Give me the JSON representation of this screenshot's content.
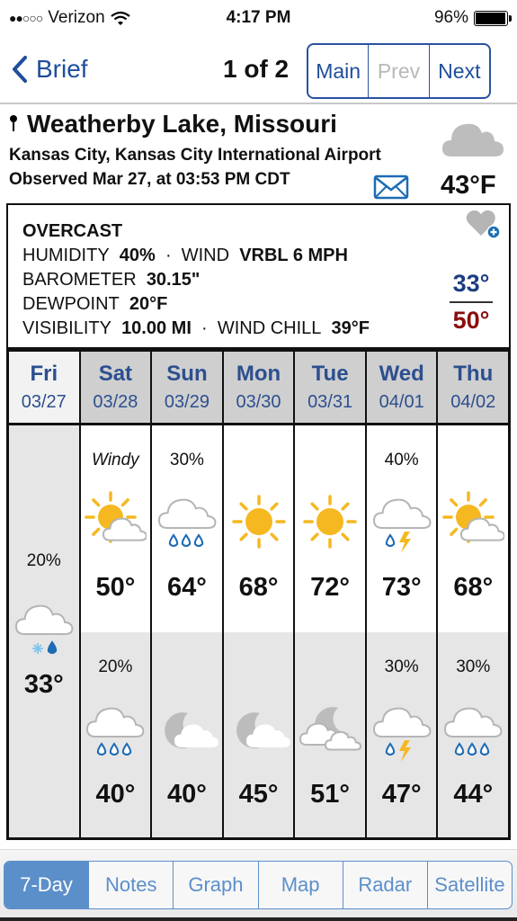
{
  "status_bar": {
    "signal_dots": "●●○○○",
    "carrier": "Verizon",
    "time": "4:17 PM",
    "battery_pct": "96%",
    "battery_level": 0.96
  },
  "nav": {
    "back_label": "Brief",
    "page_indicator": "1 of 2",
    "segments": [
      {
        "label": "Main",
        "enabled": true
      },
      {
        "label": "Prev",
        "enabled": false
      },
      {
        "label": "Next",
        "enabled": true
      }
    ]
  },
  "location": {
    "name": "Weatherby Lake, Missouri",
    "station": "Kansas City, Kansas City International Airport",
    "observed": "Observed Mar 27, at 03:53 PM CDT",
    "current_temp": "43°F",
    "current_icon": "cloud-icon"
  },
  "conditions": {
    "summary": "OVERCAST",
    "humidity_label": "HUMIDITY",
    "humidity": "40%",
    "sep": "·",
    "wind_label": "WIND",
    "wind": "VRBL 6 MPH",
    "barometer_label": "BAROMETER",
    "barometer": "30.15\"",
    "dewpoint_label": "DEWPOINT",
    "dewpoint": "20°F",
    "visibility_label": "VISIBILITY",
    "visibility": "10.00 MI",
    "windchill_label": "WIND CHILL",
    "windchill": "39°F",
    "low": "33°",
    "high": "50°",
    "colors": {
      "low": "#1c3e82",
      "high": "#8b0c0c"
    }
  },
  "forecast": [
    {
      "day": "Fri",
      "date": "03/27",
      "today": true,
      "day_part": null,
      "night": {
        "note": "20%",
        "italic": false,
        "icon": "cloud-snow-rain-icon",
        "temp": "33°"
      }
    },
    {
      "day": "Sat",
      "date": "03/28",
      "day_part": {
        "note": "Windy",
        "italic": true,
        "icon": "partly-sunny-icon",
        "temp": "50°"
      },
      "night": {
        "note": "20%",
        "italic": false,
        "icon": "cloud-rain-icon",
        "temp": "40°"
      }
    },
    {
      "day": "Sun",
      "date": "03/29",
      "day_part": {
        "note": "30%",
        "italic": false,
        "icon": "cloud-rain-icon",
        "temp": "64°"
      },
      "night": {
        "note": "",
        "italic": false,
        "icon": "moon-cloud-icon",
        "temp": "40°"
      }
    },
    {
      "day": "Mon",
      "date": "03/30",
      "day_part": {
        "note": "",
        "italic": false,
        "icon": "sun-icon",
        "temp": "68°"
      },
      "night": {
        "note": "",
        "italic": false,
        "icon": "moon-cloud-icon",
        "temp": "45°"
      }
    },
    {
      "day": "Tue",
      "date": "03/31",
      "day_part": {
        "note": "",
        "italic": false,
        "icon": "sun-icon",
        "temp": "72°"
      },
      "night": {
        "note": "",
        "italic": false,
        "icon": "mostly-cloudy-night-icon",
        "temp": "51°"
      }
    },
    {
      "day": "Wed",
      "date": "04/01",
      "day_part": {
        "note": "40%",
        "italic": false,
        "icon": "thunderstorm-icon",
        "temp": "73°"
      },
      "night": {
        "note": "30%",
        "italic": false,
        "icon": "thunderstorm-icon",
        "temp": "47°"
      }
    },
    {
      "day": "Thu",
      "date": "04/02",
      "day_part": {
        "note": "",
        "italic": false,
        "icon": "partly-sunny-icon",
        "temp": "68°"
      },
      "night": {
        "note": "30%",
        "italic": false,
        "icon": "cloud-rain-icon",
        "temp": "44°"
      }
    }
  ],
  "tabs": [
    {
      "label": "7-Day",
      "active": true
    },
    {
      "label": "Notes",
      "active": false
    },
    {
      "label": "Graph",
      "active": false
    },
    {
      "label": "Map",
      "active": false
    },
    {
      "label": "Radar",
      "active": false
    },
    {
      "label": "Satellite",
      "active": false
    }
  ]
}
